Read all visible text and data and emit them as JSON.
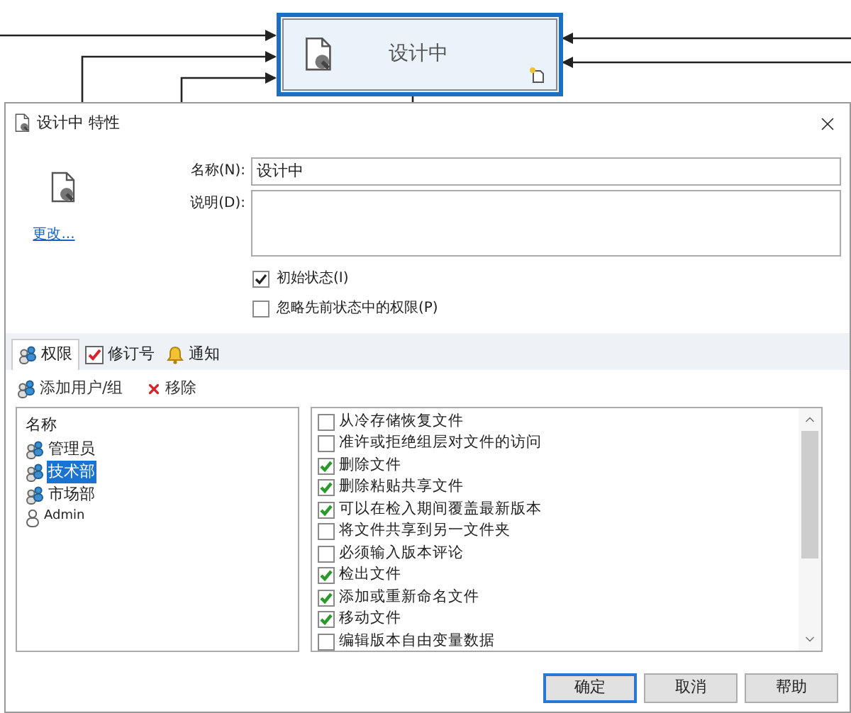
{
  "diagram": {
    "node": {
      "label": "设计中",
      "selected": true
    }
  },
  "dialog": {
    "title": "设计中 特性",
    "change_link": "更改...",
    "fields": [
      {
        "kind": "input",
        "label": "名称(N):",
        "value": "设计中"
      },
      {
        "kind": "textarea",
        "label": "说明(D):"
      }
    ],
    "options": [
      {
        "label": "初始状态(I)",
        "checked": true
      },
      {
        "label": "忽略先前状态中的权限(P)",
        "checked": false
      }
    ],
    "tabs": [
      {
        "kind": "users",
        "label": "权限",
        "selected": true
      },
      {
        "kind": "check",
        "label": "修订号",
        "selected": false
      },
      {
        "kind": "bell",
        "label": "通知",
        "selected": false
      }
    ],
    "toolbar": [
      {
        "kind": "add",
        "label": "添加用户/组"
      },
      {
        "kind": "remove",
        "label": "移除"
      }
    ],
    "members": {
      "header": "名称",
      "items": [
        {
          "kind": "group",
          "name": "管理员",
          "selected": false
        },
        {
          "kind": "group",
          "name": "技术部",
          "selected": true
        },
        {
          "kind": "group",
          "name": "市场部",
          "selected": false
        },
        {
          "kind": "user",
          "name": "Admin",
          "selected": false
        }
      ]
    },
    "permissions": [
      {
        "label": "从冷存储恢复文件",
        "checked": false
      },
      {
        "label": "准许或拒绝组层对文件的访问",
        "checked": false
      },
      {
        "label": "删除文件",
        "checked": true
      },
      {
        "label": "删除粘贴共享文件",
        "checked": true
      },
      {
        "label": "可以在检入期间覆盖最新版本",
        "checked": true
      },
      {
        "label": "将文件共享到另一文件夹",
        "checked": false
      },
      {
        "label": "必须输入版本评论",
        "checked": false
      },
      {
        "label": "检出文件",
        "checked": true
      },
      {
        "label": "添加或重新命名文件",
        "checked": true
      },
      {
        "label": "移动文件",
        "checked": true
      },
      {
        "label": "编辑版本自由变量数据",
        "checked": false
      }
    ],
    "buttons": [
      {
        "label": "确定",
        "default": true
      },
      {
        "label": "取消",
        "default": false
      },
      {
        "label": "帮助",
        "default": false
      }
    ]
  }
}
